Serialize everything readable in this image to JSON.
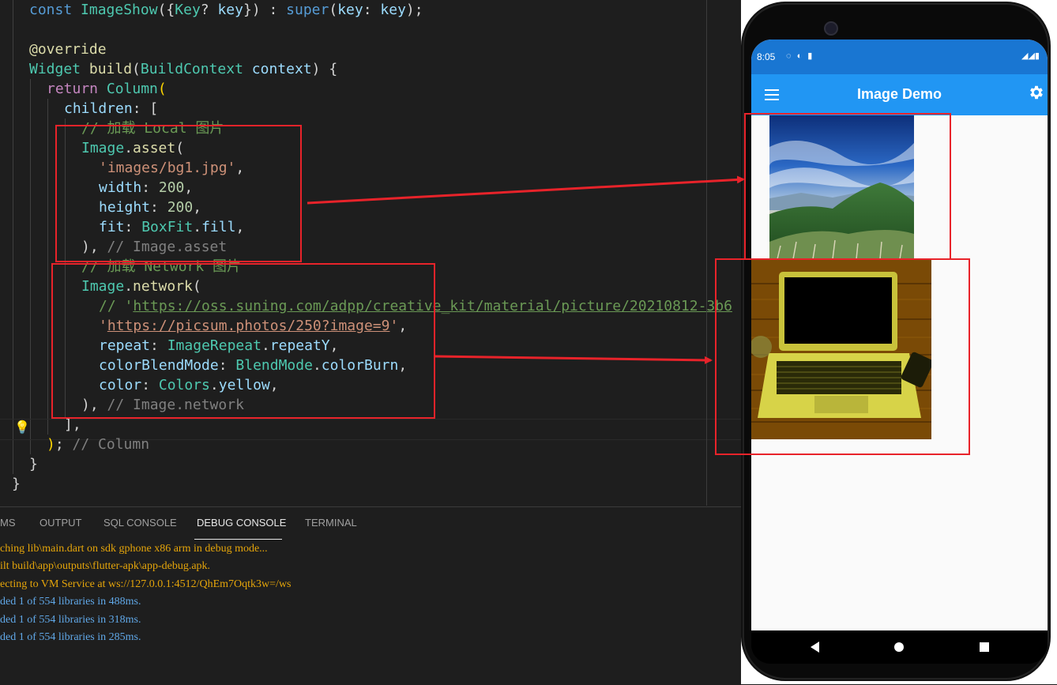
{
  "code": {
    "lines": [
      {
        "parts": [
          [
            "kw",
            "const "
          ],
          [
            "cls",
            "ImageShow"
          ],
          [
            "punc",
            "({"
          ],
          [
            "cls",
            "Key"
          ],
          [
            "punc",
            "? "
          ],
          [
            "prop",
            "key"
          ],
          [
            "punc",
            "}) : "
          ],
          [
            "kw",
            "super"
          ],
          [
            "punc",
            "("
          ],
          [
            "prop",
            "key"
          ],
          [
            "punc",
            ": "
          ],
          [
            "prop",
            "key"
          ],
          [
            "punc",
            ");"
          ]
        ]
      },
      {
        "parts": []
      },
      {
        "parts": [
          [
            "fn",
            "@override"
          ]
        ]
      },
      {
        "parts": [
          [
            "cls",
            "Widget "
          ],
          [
            "fn",
            "build"
          ],
          [
            "punc",
            "("
          ],
          [
            "cls",
            "BuildContext "
          ],
          [
            "prop",
            "context"
          ],
          [
            "punc",
            ") {"
          ]
        ]
      },
      {
        "parts": [
          [
            "kw2",
            "return "
          ],
          [
            "cls",
            "Column"
          ],
          [
            "bracket-y",
            "("
          ]
        ]
      },
      {
        "parts": [
          [
            "prop",
            "children"
          ],
          [
            "punc",
            ": ["
          ]
        ]
      },
      {
        "parts": [
          [
            "cm",
            "// 加载 Local 图片"
          ]
        ]
      },
      {
        "parts": [
          [
            "cls",
            "Image"
          ],
          [
            "punc",
            "."
          ],
          [
            "fn",
            "asset"
          ],
          [
            "punc",
            "("
          ]
        ]
      },
      {
        "parts": [
          [
            "str",
            "'images/bg1.jpg'"
          ],
          [
            "punc",
            ","
          ]
        ]
      },
      {
        "parts": [
          [
            "prop",
            "width"
          ],
          [
            "punc",
            ": "
          ],
          [
            "num",
            "200"
          ],
          [
            "punc",
            ","
          ]
        ]
      },
      {
        "parts": [
          [
            "prop",
            "height"
          ],
          [
            "punc",
            ": "
          ],
          [
            "num",
            "200"
          ],
          [
            "punc",
            ","
          ]
        ]
      },
      {
        "parts": [
          [
            "prop",
            "fit"
          ],
          [
            "punc",
            ": "
          ],
          [
            "cls",
            "BoxFit"
          ],
          [
            "punc",
            "."
          ],
          [
            "prop",
            "fill"
          ],
          [
            "punc",
            ","
          ]
        ]
      },
      {
        "parts": [
          [
            "punc",
            "), "
          ],
          [
            "gray",
            "// Image.asset"
          ]
        ]
      },
      {
        "parts": [
          [
            "cm",
            "// 加载 Network 图片"
          ]
        ]
      },
      {
        "parts": [
          [
            "cls",
            "Image"
          ],
          [
            "punc",
            "."
          ],
          [
            "fn",
            "network"
          ],
          [
            "punc",
            "("
          ]
        ]
      },
      {
        "parts": [
          [
            "cm",
            "// '"
          ],
          [
            "url-c",
            "https://oss.suning.com/adpp/creative_kit/material/picture/20210812-3b6"
          ]
        ]
      },
      {
        "parts": [
          [
            "str",
            "'"
          ],
          [
            "url",
            "https://picsum.photos/250?image=9"
          ],
          [
            "str",
            "'"
          ],
          [
            "punc",
            ","
          ]
        ]
      },
      {
        "parts": [
          [
            "prop",
            "repeat"
          ],
          [
            "punc",
            ": "
          ],
          [
            "cls",
            "ImageRepeat"
          ],
          [
            "punc",
            "."
          ],
          [
            "prop",
            "repeatY"
          ],
          [
            "punc",
            ","
          ]
        ]
      },
      {
        "parts": [
          [
            "prop",
            "colorBlendMode"
          ],
          [
            "punc",
            ": "
          ],
          [
            "cls",
            "BlendMode"
          ],
          [
            "punc",
            "."
          ],
          [
            "prop",
            "colorBurn"
          ],
          [
            "punc",
            ","
          ]
        ]
      },
      {
        "parts": [
          [
            "prop",
            "color"
          ],
          [
            "punc",
            ": "
          ],
          [
            "cls",
            "Colors"
          ],
          [
            "punc",
            "."
          ],
          [
            "prop",
            "yellow"
          ],
          [
            "punc",
            ","
          ]
        ]
      },
      {
        "parts": [
          [
            "punc",
            "), "
          ],
          [
            "gray",
            "// Image.network"
          ]
        ]
      },
      {
        "parts": [
          [
            "punc",
            "],"
          ]
        ]
      },
      {
        "parts": [
          [
            "bracket-y",
            ")"
          ],
          [
            "punc",
            "; "
          ],
          [
            "gray",
            "// Column"
          ]
        ]
      },
      {
        "parts": [
          [
            "punc",
            "}"
          ]
        ]
      },
      {
        "parts": [
          [
            "punc",
            "}"
          ]
        ]
      }
    ]
  },
  "panel": {
    "tabs": [
      "MS",
      "OUTPUT",
      "SQL CONSOLE",
      "DEBUG CONSOLE",
      "TERMINAL"
    ],
    "active_tab": "DEBUG CONSOLE",
    "console": [
      {
        "text": "ching lib\\main.dart on sdk gphone x86 arm in debug mode...",
        "color": "orange"
      },
      {
        "text": "ilt build\\app\\outputs\\flutter-apk\\app-debug.apk.",
        "color": "orange"
      },
      {
        "text": "ecting to VM Service at ws://127.0.0.1:4512/QhEm7Oqtk3w=/ws",
        "color": "orange"
      },
      {
        "text": "ded 1 of 554 libraries in 488ms.",
        "color": "blue"
      },
      {
        "text": "ded 1 of 554 libraries in 318ms.",
        "color": "blue"
      },
      {
        "text": "ded 1 of 554 libraries in 285ms.",
        "color": "blue"
      }
    ]
  },
  "phone": {
    "status_time": "8:05",
    "app_title": "Image Demo",
    "icons": [
      "menu-icon",
      "gear-icon",
      "back-icon",
      "home-icon",
      "recent-apps-icon"
    ]
  },
  "colors": {
    "appbar": "#2196f3",
    "statusbar": "#1976d2",
    "highlight": "#e8232a"
  }
}
